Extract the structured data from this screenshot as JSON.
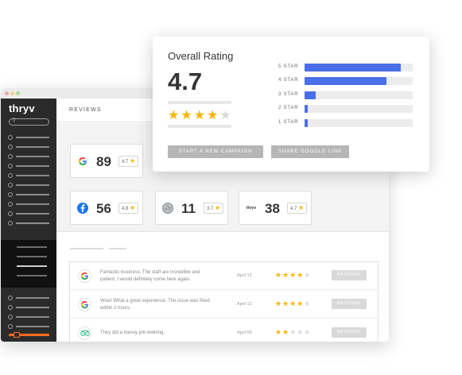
{
  "app": {
    "logo": "thryv",
    "section_title": "REVIEWS"
  },
  "colors": {
    "accent_blue": "#4a6fe8",
    "star_gold": "#f5b400",
    "brand_orange": "#ff6a1f",
    "sidebar_bg": "#2b2b2b"
  },
  "source_cards": [
    {
      "source": "google",
      "icon": "google-icon",
      "count": "89",
      "rating": "4.7"
    },
    {
      "source": "facebook",
      "icon": "facebook-icon",
      "count": "56",
      "rating": "4.8"
    },
    {
      "source": "web",
      "icon": "globe-icon",
      "count": "11",
      "rating": "3.7"
    },
    {
      "source": "thryv",
      "icon": "thryv-icon",
      "count": "38",
      "rating": "4.7"
    }
  ],
  "overall": {
    "title": "Overall Rating",
    "score": "4.7",
    "stars": 4,
    "distribution": [
      {
        "label": "5 STAR",
        "fraction": 0.89
      },
      {
        "label": "4 STAR",
        "fraction": 0.76
      },
      {
        "label": "3 STAR",
        "fraction": 0.1
      },
      {
        "label": "2 STAR",
        "fraction": 0.03
      },
      {
        "label": "1 STAR",
        "fraction": 0.03
      }
    ],
    "buttons": {
      "campaign": "START A NEW CAMPAIGN",
      "share": "SHARE GOOGLE LINK"
    }
  },
  "reviews": [
    {
      "icon": "google-icon",
      "text": "Fantastic business. The staff are incredible and patient, I would definitely come here again.",
      "date": "April 12",
      "stars": 4,
      "button": "RESPOND"
    },
    {
      "icon": "google-icon",
      "text": "Wow! What a great experience. The issue was fixed within 2 hours.",
      "date": "April 12",
      "stars": 4,
      "button": "RESPOND"
    },
    {
      "icon": "tripadvisor-icon",
      "text": "They did a messy job rewiring.",
      "date": "April 06",
      "stars": 2,
      "button": "RESPOND"
    }
  ]
}
